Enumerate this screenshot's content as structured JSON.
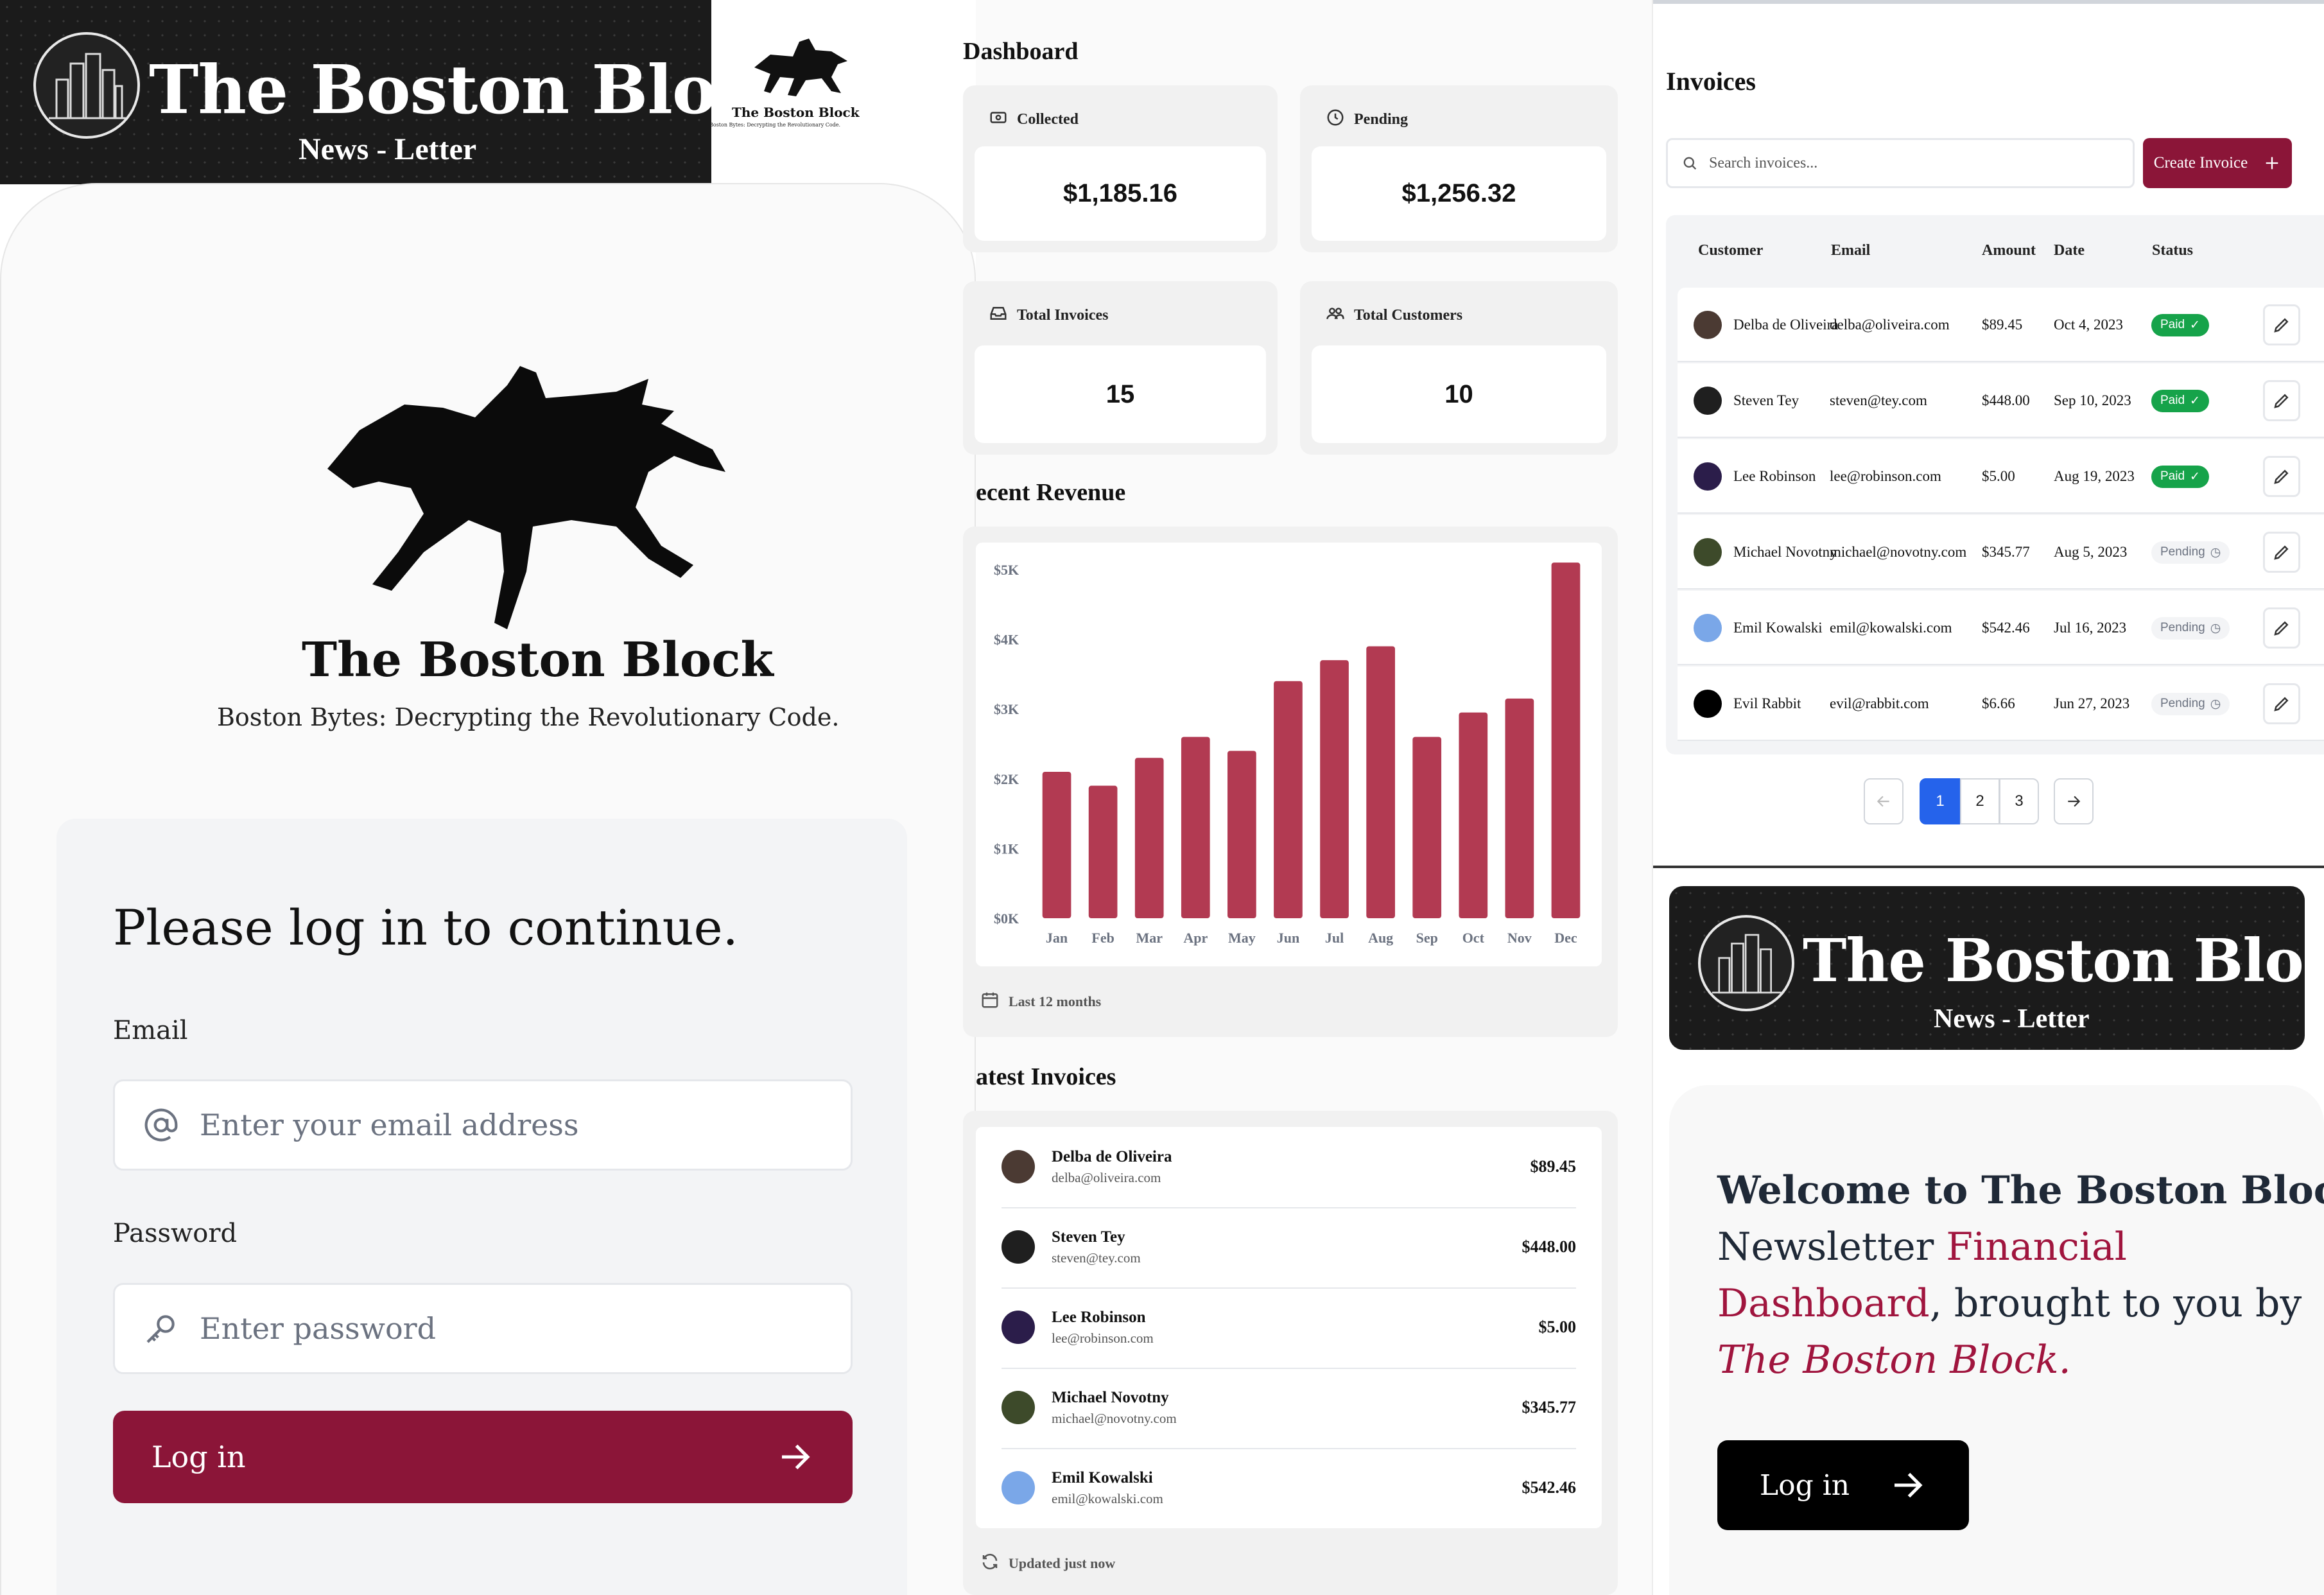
{
  "banner": {
    "title": "The Boston Block",
    "subtitle": "News - Letter",
    "logo_icon": "city-skyline-icon"
  },
  "small_logo": {
    "title": "The Boston Block",
    "tagline": "Boston Bytes: Decrypting the Revolutionary Code."
  },
  "login": {
    "brand_title": "The Boston Block",
    "brand_tagline": "Boston Bytes: Decrypting the Revolutionary Code.",
    "heading": "Please log in to continue.",
    "email_label": "Email",
    "email_placeholder": "Enter your email address",
    "password_label": "Password",
    "password_placeholder": "Enter password",
    "button_label": "Log in",
    "accent_color": "#8b1538"
  },
  "dashboard": {
    "title": "Dashboard",
    "cards": [
      {
        "label": "Collected",
        "value": "$1,185.16",
        "icon": "banknote-icon"
      },
      {
        "label": "Pending",
        "value": "$1,256.32",
        "icon": "clock-icon"
      },
      {
        "label": "Total Invoices",
        "value": "15",
        "icon": "inbox-icon"
      },
      {
        "label": "Total Customers",
        "value": "10",
        "icon": "users-icon"
      }
    ],
    "revenue_heading": "ecent Revenue",
    "revenue_footer": "Last 12 months",
    "latest_heading": "atest Invoices",
    "latest_footer": "Updated just now",
    "latest": [
      {
        "name": "Delba de Oliveira",
        "email": "delba@oliveira.com",
        "amount": "$89.45",
        "avatar_color": "#4b3a33"
      },
      {
        "name": "Steven Tey",
        "email": "steven@tey.com",
        "amount": "$448.00",
        "avatar_color": "#1f1f1f"
      },
      {
        "name": "Lee Robinson",
        "email": "lee@robinson.com",
        "amount": "$5.00",
        "avatar_color": "#2b1d4a"
      },
      {
        "name": "Michael Novotny",
        "email": "michael@novotny.com",
        "amount": "$345.77",
        "avatar_color": "#3d4a2a"
      },
      {
        "name": "Emil Kowalski",
        "email": "emil@kowalski.com",
        "amount": "$542.46",
        "avatar_color": "#7aa7e8"
      }
    ]
  },
  "chart_data": {
    "type": "bar",
    "categories": [
      "Jan",
      "Feb",
      "Mar",
      "Apr",
      "May",
      "Jun",
      "Jul",
      "Aug",
      "Sep",
      "Oct",
      "Nov",
      "Dec"
    ],
    "values": [
      2100,
      1900,
      2300,
      2600,
      2400,
      3400,
      3700,
      3900,
      2600,
      2950,
      3150,
      5100
    ],
    "ylim": [
      0,
      5000
    ],
    "y_ticks": [
      "$0K",
      "$1K",
      "$2K",
      "$3K",
      "$4K",
      "$5K"
    ],
    "bar_color": "#b23a52",
    "grid": false
  },
  "invoices": {
    "title": "Invoices",
    "search_placeholder": "Search invoices...",
    "create_label": "Create Invoice",
    "columns": [
      "Customer",
      "Email",
      "Amount",
      "Date",
      "Status"
    ],
    "rows": [
      {
        "customer": "Delba de Oliveira",
        "email": "delba@oliveira.com",
        "amount": "$89.45",
        "date": "Oct 4, 2023",
        "status": "Paid",
        "avatar_color": "#4b3a33"
      },
      {
        "customer": "Steven Tey",
        "email": "steven@tey.com",
        "amount": "$448.00",
        "date": "Sep 10, 2023",
        "status": "Paid",
        "avatar_color": "#1f1f1f"
      },
      {
        "customer": "Lee Robinson",
        "email": "lee@robinson.com",
        "amount": "$5.00",
        "date": "Aug 19, 2023",
        "status": "Paid",
        "avatar_color": "#2b1d4a"
      },
      {
        "customer": "Michael Novotny",
        "email": "michael@novotny.com",
        "amount": "$345.77",
        "date": "Aug 5, 2023",
        "status": "Pending",
        "avatar_color": "#3d4a2a"
      },
      {
        "customer": "Emil Kowalski",
        "email": "emil@kowalski.com",
        "amount": "$542.46",
        "date": "Jul 16, 2023",
        "status": "Pending",
        "avatar_color": "#7aa7e8"
      },
      {
        "customer": "Evil Rabbit",
        "email": "evil@rabbit.com",
        "amount": "$6.66",
        "date": "Jun 27, 2023",
        "status": "Pending",
        "avatar_color": "#000000"
      }
    ],
    "pages": [
      "1",
      "2",
      "3"
    ],
    "current_page": "1"
  },
  "welcome": {
    "line1": "Welcome to The Boston Block.",
    "line2_a": "Newsletter ",
    "line2_b": "Financial",
    "line3_a": "Dashboard",
    "line3_b": ", brought to you by",
    "line4": "The Boston Block.",
    "button_label": "Log in"
  }
}
